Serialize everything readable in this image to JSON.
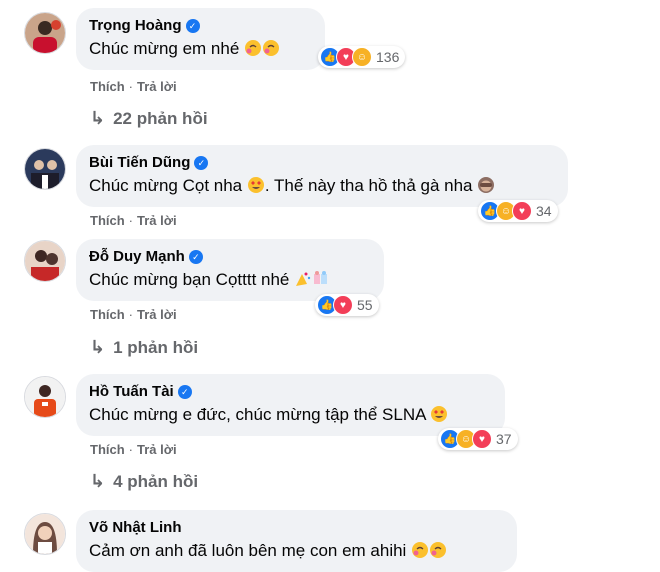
{
  "comments": [
    {
      "name": "Trọng Hoàng",
      "verified": true,
      "text": "Chúc mừng em nhé",
      "reaction_count": "136",
      "actions": {
        "like": "Thích",
        "reply": "Trả lời"
      },
      "replies_label": "22 phản hồi"
    },
    {
      "name": "Bùi Tiến Dũng",
      "verified": true,
      "text_before": "Chúc mừng Cọt nha",
      "text_after": ". Thế này tha hồ thả gà nha",
      "reaction_count": "34",
      "actions": {
        "like": "Thích",
        "reply": "Trả lời"
      }
    },
    {
      "name": "Đỗ Duy Mạnh",
      "verified": true,
      "text": "Chúc mừng bạn Cọtttt nhé",
      "reaction_count": "55",
      "actions": {
        "like": "Thích",
        "reply": "Trả lời"
      },
      "replies_label": "1 phản hồi"
    },
    {
      "name": "Hồ Tuấn Tài",
      "verified": true,
      "text": "Chúc mừng e đức, chúc mừng tập thể SLNA",
      "reaction_count": "37",
      "actions": {
        "like": "Thích",
        "reply": "Trả lời"
      },
      "replies_label": "4 phản hồi"
    },
    {
      "name": "Võ Nhật Linh",
      "verified": false,
      "text": "Cảm ơn anh đã luôn bên mẹ con em ahihi"
    }
  ],
  "colors": {
    "bubble": "#f0f2f5",
    "like": "#1877f2",
    "love": "#f33e58",
    "haha": "#f7b125",
    "meta": "#65676b"
  },
  "icons": [
    "verified-badge-icon",
    "like-reaction-icon",
    "love-reaction-icon",
    "haha-reaction-icon",
    "reply-arrow-icon",
    "hugging-face-emoji",
    "heart-eyes-emoji",
    "see-no-evil-emoji",
    "party-emoji"
  ]
}
